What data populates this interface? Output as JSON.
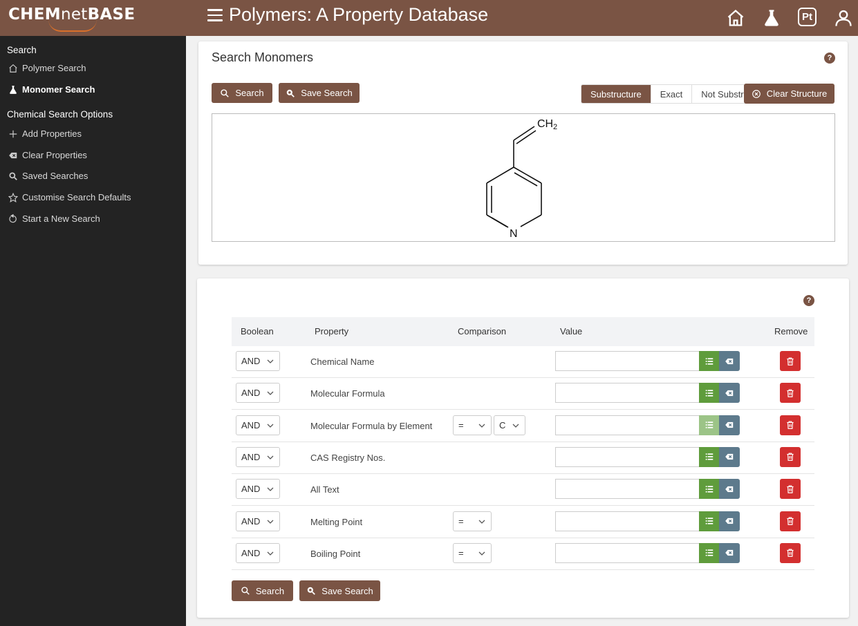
{
  "header": {
    "logo_bold": "CHEM",
    "logo_light": "net",
    "logo_bold2": "BASE",
    "title": "Polymers: A Property Database",
    "pt_label": "Pt"
  },
  "sidebar": {
    "search_heading": "Search",
    "search_items": [
      {
        "label": "Polymer Search",
        "icon": "home-icon"
      },
      {
        "label": "Monomer Search",
        "icon": "flask-icon"
      }
    ],
    "options_heading": "Chemical Search Options",
    "option_items": [
      {
        "label": "Add Properties",
        "icon": "plus-icon"
      },
      {
        "label": "Clear Properties",
        "icon": "backspace-icon"
      },
      {
        "label": "Saved Searches",
        "icon": "search-saved-icon"
      },
      {
        "label": "Customise Search Defaults",
        "icon": "star-icon"
      },
      {
        "label": "Start a New Search",
        "icon": "refresh-icon"
      }
    ]
  },
  "structure_panel": {
    "title": "Search Monomers",
    "search_label": "Search",
    "save_label": "Save Search",
    "modes": [
      "Substructure",
      "Exact",
      "Not Substr."
    ],
    "active_mode": "Substructure",
    "clear_label": "Clear Structure",
    "molecule_labels": {
      "ch2": "CH",
      "ch2_sub": "2",
      "n": "N"
    }
  },
  "properties": {
    "columns": {
      "boolean": "Boolean",
      "property": "Property",
      "comparison": "Comparison",
      "value": "Value",
      "remove": "Remove"
    },
    "rows": [
      {
        "bool": "AND",
        "property": "Chemical Name",
        "comparison": "",
        "element": "",
        "value": ""
      },
      {
        "bool": "AND",
        "property": "Molecular Formula",
        "comparison": "",
        "element": "",
        "value": ""
      },
      {
        "bool": "AND",
        "property": "Molecular Formula by Element",
        "comparison": "=",
        "element": "C",
        "value": ""
      },
      {
        "bool": "AND",
        "property": "CAS Registry Nos.",
        "comparison": "",
        "element": "",
        "value": ""
      },
      {
        "bool": "AND",
        "property": "All Text",
        "comparison": "",
        "element": "",
        "value": ""
      },
      {
        "bool": "AND",
        "property": "Melting Point",
        "comparison": "=",
        "element": "",
        "value": ""
      },
      {
        "bool": "AND",
        "property": "Boiling Point",
        "comparison": "=",
        "element": "",
        "value": ""
      }
    ],
    "search_label": "Search",
    "save_label": "Save Search"
  },
  "colors": {
    "brand": "#7a5444",
    "sidebar": "#232323",
    "list_btn": "#5f9c3c",
    "clear_btn": "#5d7a8c",
    "delete_btn": "#d32f2f"
  }
}
